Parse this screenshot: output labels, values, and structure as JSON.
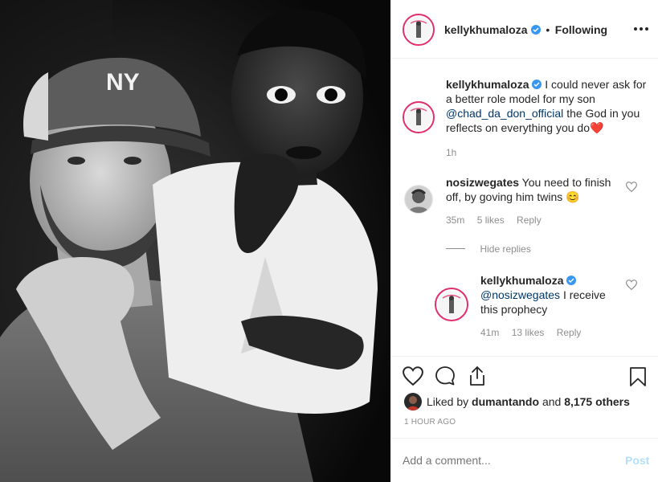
{
  "header": {
    "username": "kellykhumaloza",
    "separator": "•",
    "follow_status": "Following"
  },
  "caption": {
    "username": "kellykhumaloza",
    "text_1": "I could never ask for a better role model for my son",
    "mention": "@chad_da_don_official",
    "text_2": "the God in you reflects on everything you do",
    "emoji": "❤️",
    "time": "1h"
  },
  "comments": [
    {
      "username": "nosizwegates",
      "text": "You need to finish off, by goving him twins",
      "emoji": "😊",
      "time": "35m",
      "likes": "5 likes",
      "reply": "Reply"
    }
  ],
  "hide_replies": "Hide replies",
  "replies": [
    {
      "username": "kellykhumaloza",
      "mention": "@nosizwegates",
      "text": "I receive this prophecy",
      "time": "41m",
      "likes": "13 likes",
      "reply": "Reply"
    }
  ],
  "likes": {
    "prefix": "Liked by",
    "user": "dumantando",
    "and": "and",
    "others": "8,175 others"
  },
  "post_time": "1 HOUR AGO",
  "comment_box": {
    "placeholder": "Add a comment...",
    "post_label": "Post"
  },
  "photo": {
    "cap_text": "NY"
  },
  "colors": {
    "verified": "#3897f0",
    "mention": "#00376b",
    "post_button": "#b2dffc",
    "ring": "#e1306c"
  }
}
